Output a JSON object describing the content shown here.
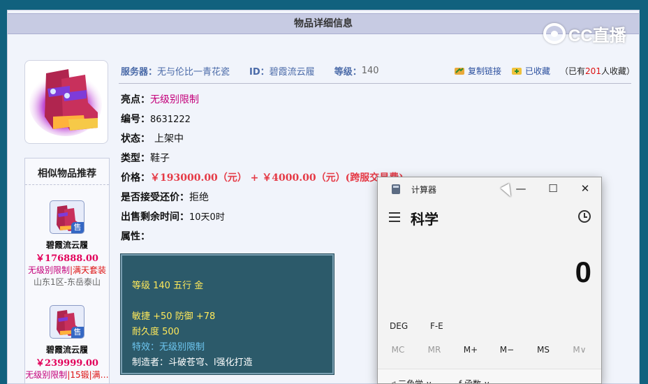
{
  "panel": {
    "title": "物品详细信息"
  },
  "watermark": {
    "text": "CC直播"
  },
  "item": {
    "server_label": "服务器：",
    "server_value": "无与伦比一青花瓷",
    "id_label": "ID：",
    "id_value": "碧霞流云履",
    "level_label": "等级：",
    "level_value": "140",
    "highlight_label": "亮点：",
    "highlight_value": "无级别限制",
    "number_label": "编号：",
    "number_value": "8631222",
    "status_label": "状态：",
    "status_value": "上架中",
    "type_label": "类型：",
    "type_value": "鞋子",
    "price_label": "价格：",
    "price_value": "￥193000.00（元） + ￥4000.00（元）(跨服交易费)",
    "bargain_label": "是否接受还价：",
    "bargain_value": "拒绝",
    "remaining_label": "出售剩余时间：",
    "remaining_value": "10天0时",
    "attributes_label": "属性："
  },
  "toolbar": {
    "copy_link": "复制链接",
    "collected": "已收藏",
    "fav_prefix": "（已有",
    "fav_count": "201",
    "fav_suffix": "人收藏）"
  },
  "attributes": {
    "line1": "等级 140 五行 金",
    "line2": "敏捷 +50 防御 +78",
    "line3": "耐久度 500",
    "line4": "特效：无级别限制",
    "line5": "制造者：斗破苍穹、l强化打造"
  },
  "sidebar": {
    "title": "相似物品推荐",
    "items": [
      {
        "name": "碧霞流云履",
        "price": "￥176888.00",
        "tag1": "无级别限制",
        "tag_sep": "|",
        "tag2": "满天套装",
        "server": "山东1区-东岳泰山",
        "badge": "售"
      },
      {
        "name": "碧霞流云履",
        "price": "￥239999.00",
        "tag1": "无级别限制",
        "tag_sep": "|",
        "tag2": "15锻",
        "tag3": "|满…",
        "badge": "售"
      }
    ]
  },
  "calculator": {
    "title": "计算器",
    "mode": "科学",
    "display": "0",
    "deg": "DEG",
    "fe": "F-E",
    "memory": [
      "MC",
      "MR",
      "M+",
      "M−",
      "MS",
      "M∨"
    ],
    "bottom_left": "◁ 三角学 ∨",
    "bottom_right": "ƒ 函数 ∨",
    "minimize": "—",
    "maximize": "☐",
    "close": "✕"
  },
  "colors": {
    "accent_blue": "#4a6aa8",
    "price_red": "#e53a46",
    "highlight_pink": "#c4007a",
    "attr_bg": "#2c5a6a"
  }
}
